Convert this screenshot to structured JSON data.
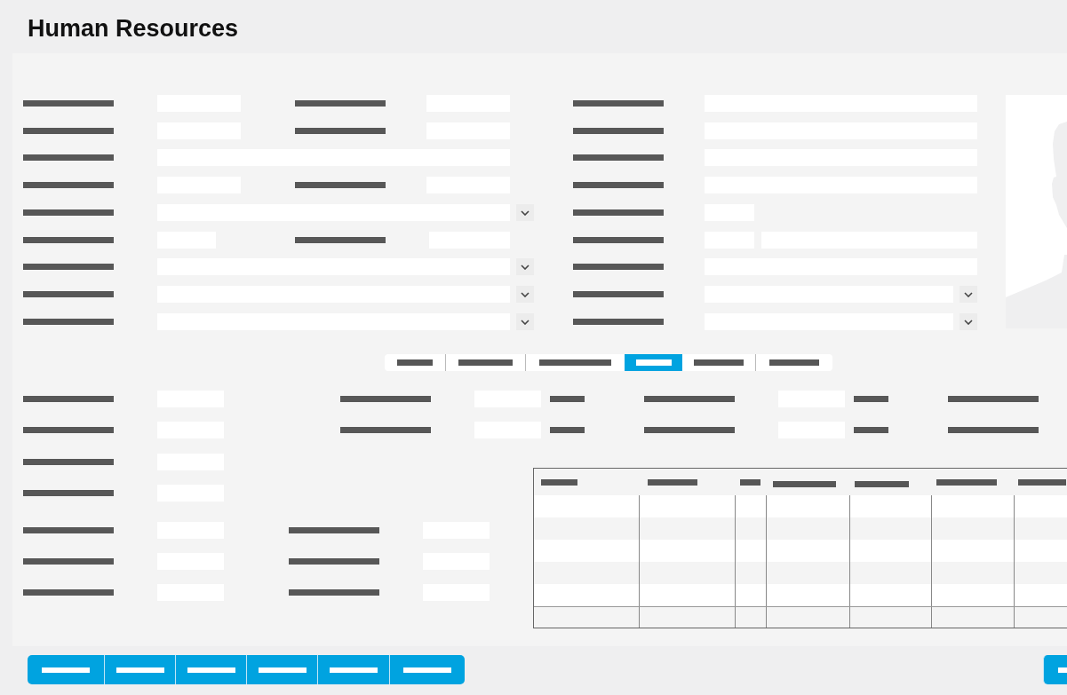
{
  "window": {
    "title": "Human Resources"
  },
  "tabs": [
    {
      "selected": false
    },
    {
      "selected": false
    },
    {
      "selected": false
    },
    {
      "selected": true
    },
    {
      "selected": false
    },
    {
      "selected": false
    }
  ]
}
